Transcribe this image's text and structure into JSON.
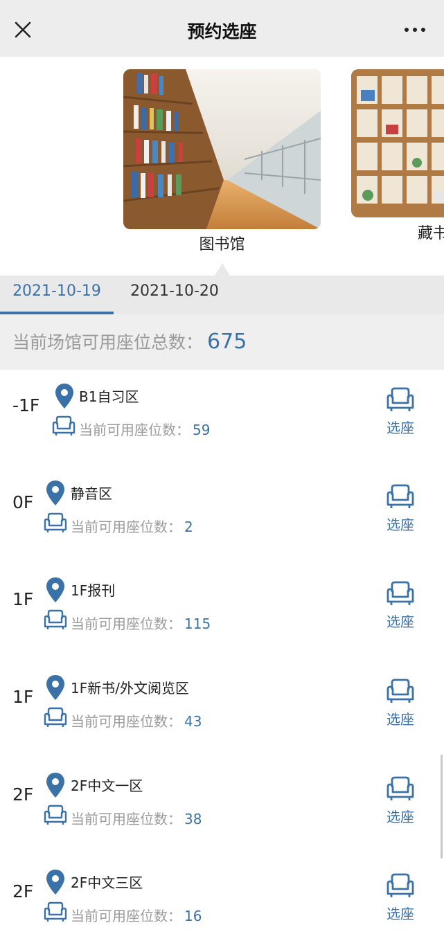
{
  "header": {
    "title": "预约选座"
  },
  "carousel": {
    "items": [
      {
        "label": "图书馆"
      },
      {
        "label": "藏书"
      }
    ]
  },
  "dates": [
    {
      "label": "2021-10-19",
      "active": true
    },
    {
      "label": "2021-10-20",
      "active": false
    }
  ],
  "summary": {
    "label": "当前场馆可用座位总数：",
    "count": "675"
  },
  "zones": [
    {
      "floor": "-1F",
      "name": "B1自习区",
      "available_label": "当前可用座位数：",
      "available": "59",
      "action": "选座"
    },
    {
      "floor": "0F",
      "name": "静音区",
      "available_label": "当前可用座位数：",
      "available": "2",
      "action": "选座"
    },
    {
      "floor": "1F",
      "name": "1F报刊",
      "available_label": "当前可用座位数：",
      "available": "115",
      "action": "选座"
    },
    {
      "floor": "1F",
      "name": "1F新书/外文阅览区",
      "available_label": "当前可用座位数：",
      "available": "43",
      "action": "选座"
    },
    {
      "floor": "2F",
      "name": "2F中文一区",
      "available_label": "当前可用座位数：",
      "available": "38",
      "action": "选座"
    },
    {
      "floor": "2F",
      "name": "2F中文三区",
      "available_label": "当前可用座位数：",
      "available": "16",
      "action": "选座"
    }
  ],
  "colors": {
    "accent": "#3a72a8",
    "muted": "#9a9a9a",
    "header_bg": "#ededed",
    "tab_bg": "#e9e9e9"
  }
}
